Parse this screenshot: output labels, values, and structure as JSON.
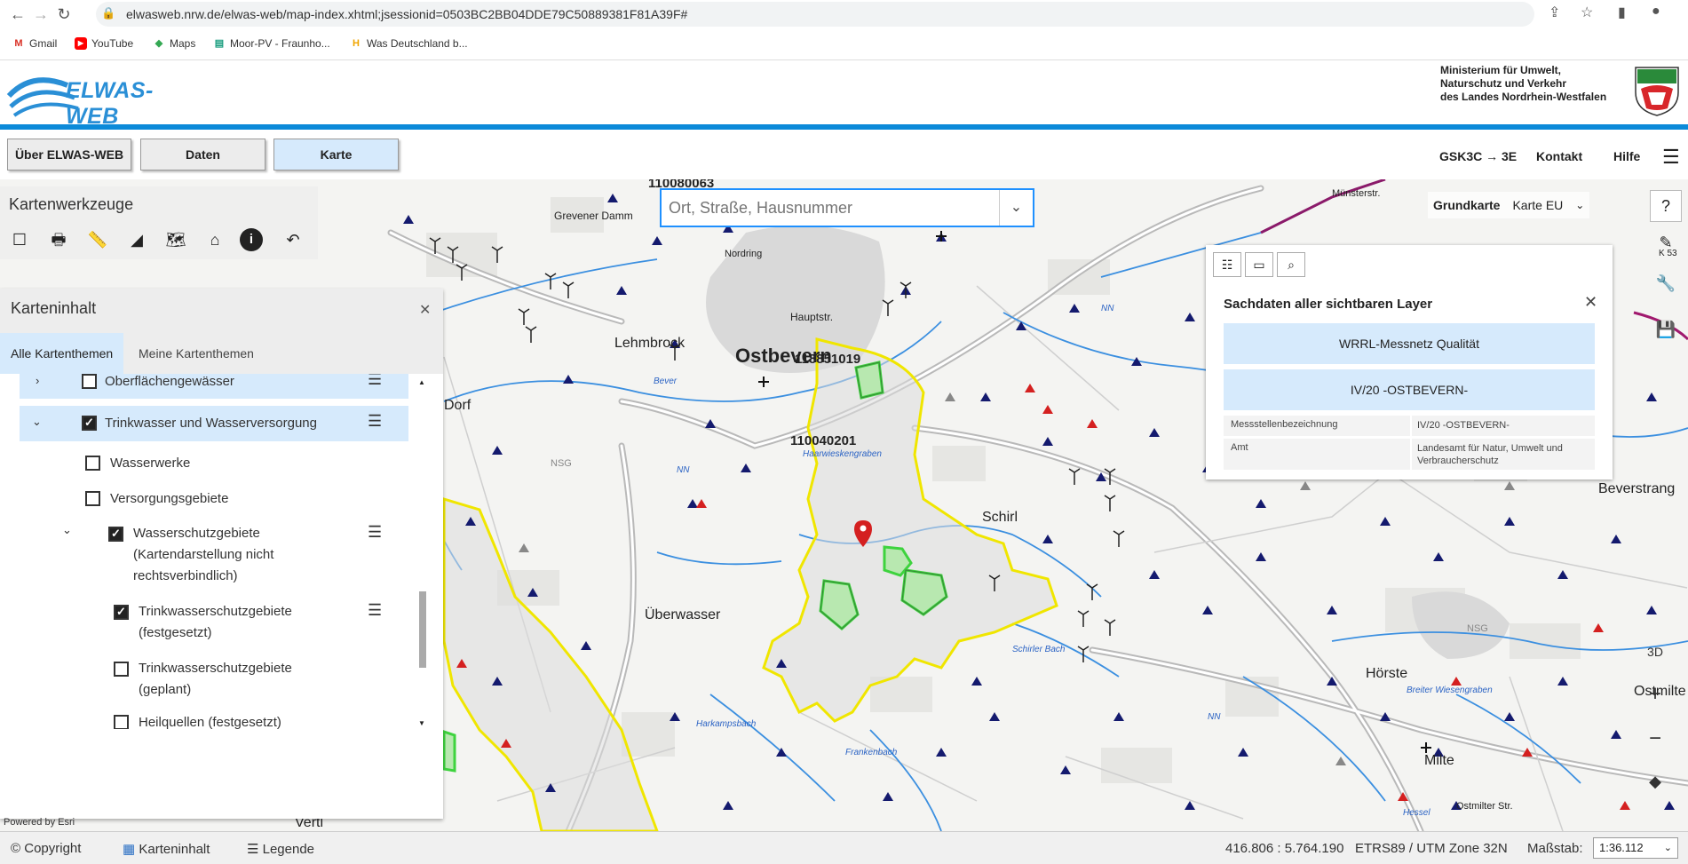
{
  "browser": {
    "url": "elwasweb.nrw.de/elwas-web/map-index.xhtml;jsessionid=0503BC2BB04DDE79C50889381F81A39F#",
    "bookmarks": [
      {
        "label": "Gmail",
        "icon": "gmail-icon"
      },
      {
        "label": "YouTube",
        "icon": "youtube-icon"
      },
      {
        "label": "Maps",
        "icon": "maps-icon"
      },
      {
        "label": "Moor-PV - Fraunho...",
        "icon": "fraunhofer-icon"
      },
      {
        "label": "Was Deutschland b...",
        "icon": "h-icon"
      }
    ]
  },
  "header": {
    "logo_text": "ELWAS-WEB",
    "ministry_line1": "Ministerium für Umwelt,",
    "ministry_line2": "Naturschutz und Verkehr",
    "ministry_line3": "des Landes Nordrhein-Westfalen"
  },
  "nav": {
    "tabs": [
      {
        "label": "Über ELWAS-WEB"
      },
      {
        "label": "Daten"
      },
      {
        "label": "Karte"
      }
    ],
    "links": {
      "gsk": "GSK3C → 3E",
      "kontakt": "Kontakt",
      "hilfe": "Hilfe"
    }
  },
  "search": {
    "placeholder": "Ort, Straße, Hausnummer"
  },
  "grundkarte": {
    "label": "Grundkarte",
    "value": "Karte EU"
  },
  "kartenwerkzeuge": {
    "title": "Kartenwerkzeuge"
  },
  "karteninhalt": {
    "title": "Karteninhalt",
    "tabs": [
      "Alle Kartenthemen",
      "Meine Kartenthemen"
    ],
    "items": [
      {
        "label": "Oberflächengewässer"
      },
      {
        "label": "Trinkwasser und Wasserversorgung"
      },
      {
        "label": "Wasserwerke"
      },
      {
        "label": "Versorgungsgebiete"
      },
      {
        "label": "Wasserschutzgebiete",
        "line2": "(Kartendarstellung nicht",
        "line3": "rechtsverbindlich)"
      },
      {
        "label": "Trinkwasserschutzgebiete",
        "line2": "(festgesetzt)"
      },
      {
        "label": "Trinkwasserschutzgebiete",
        "line2": "(geplant)"
      },
      {
        "label": "Heilquellen (festgesetzt)"
      }
    ]
  },
  "sachdaten": {
    "title": "Sachdaten aller sichtbaren Layer",
    "btn1": "WRRL-Messnetz Qualität",
    "btn2": "IV/20 -OSTBEVERN-",
    "rows": [
      {
        "key": "Messstellenbezeichnung",
        "value": "IV/20 -OSTBEVERN-"
      },
      {
        "key": "Amt",
        "value": "Landesamt für Natur, Umwelt und Verbraucherschutz"
      }
    ]
  },
  "map_labels": {
    "ostbevern": "Ostbevern",
    "lehmbrock": "Lehmbrock",
    "dorf": "Dorf",
    "schirl": "Schirl",
    "ueberwasser": "Überwasser",
    "hoerste": "Hörste",
    "milte": "Milte",
    "ostmilte": "Ostmilte",
    "beverstrang": "Beverstrang",
    "vertl": "Vertl",
    "id1": "118851019",
    "id2": "110040201",
    "id3": "110080063",
    "hauptstr": "Hauptstr.",
    "grevener_damm": "Grevener Damm",
    "nordring": "Nordring",
    "bever": "Bever",
    "haarwieskengraben": "Haarwieskengraben",
    "schirler_bach": "Schirler Bach",
    "harkampsbach": "Harkampsbach",
    "frankenbach": "Frankenbach",
    "hessel": "Hessel",
    "breiter_wiesengraben": "Breiter Wiesengraben",
    "muensterstr": "Münsterstr.",
    "ostmilter_str": "Ostmilter Str.",
    "nsg": "NSG",
    "nn": "NN",
    "k": "K 53"
  },
  "status": {
    "powered_by": "Powered by Esri",
    "copyright": "Copyright",
    "karteninhalt": "Karteninhalt",
    "legende": "Legende",
    "coords": "416.806 : 5.764.190",
    "crs": "ETRS89 / UTM Zone 32N",
    "massstab_label": "Maßstab:",
    "massstab_value": "1:36.112"
  },
  "colors": {
    "accent": "#0b8ad9",
    "highlight": "#d6eafc",
    "wsg_outline": "#f0e600",
    "wsg_inner": "#3ed33e"
  }
}
